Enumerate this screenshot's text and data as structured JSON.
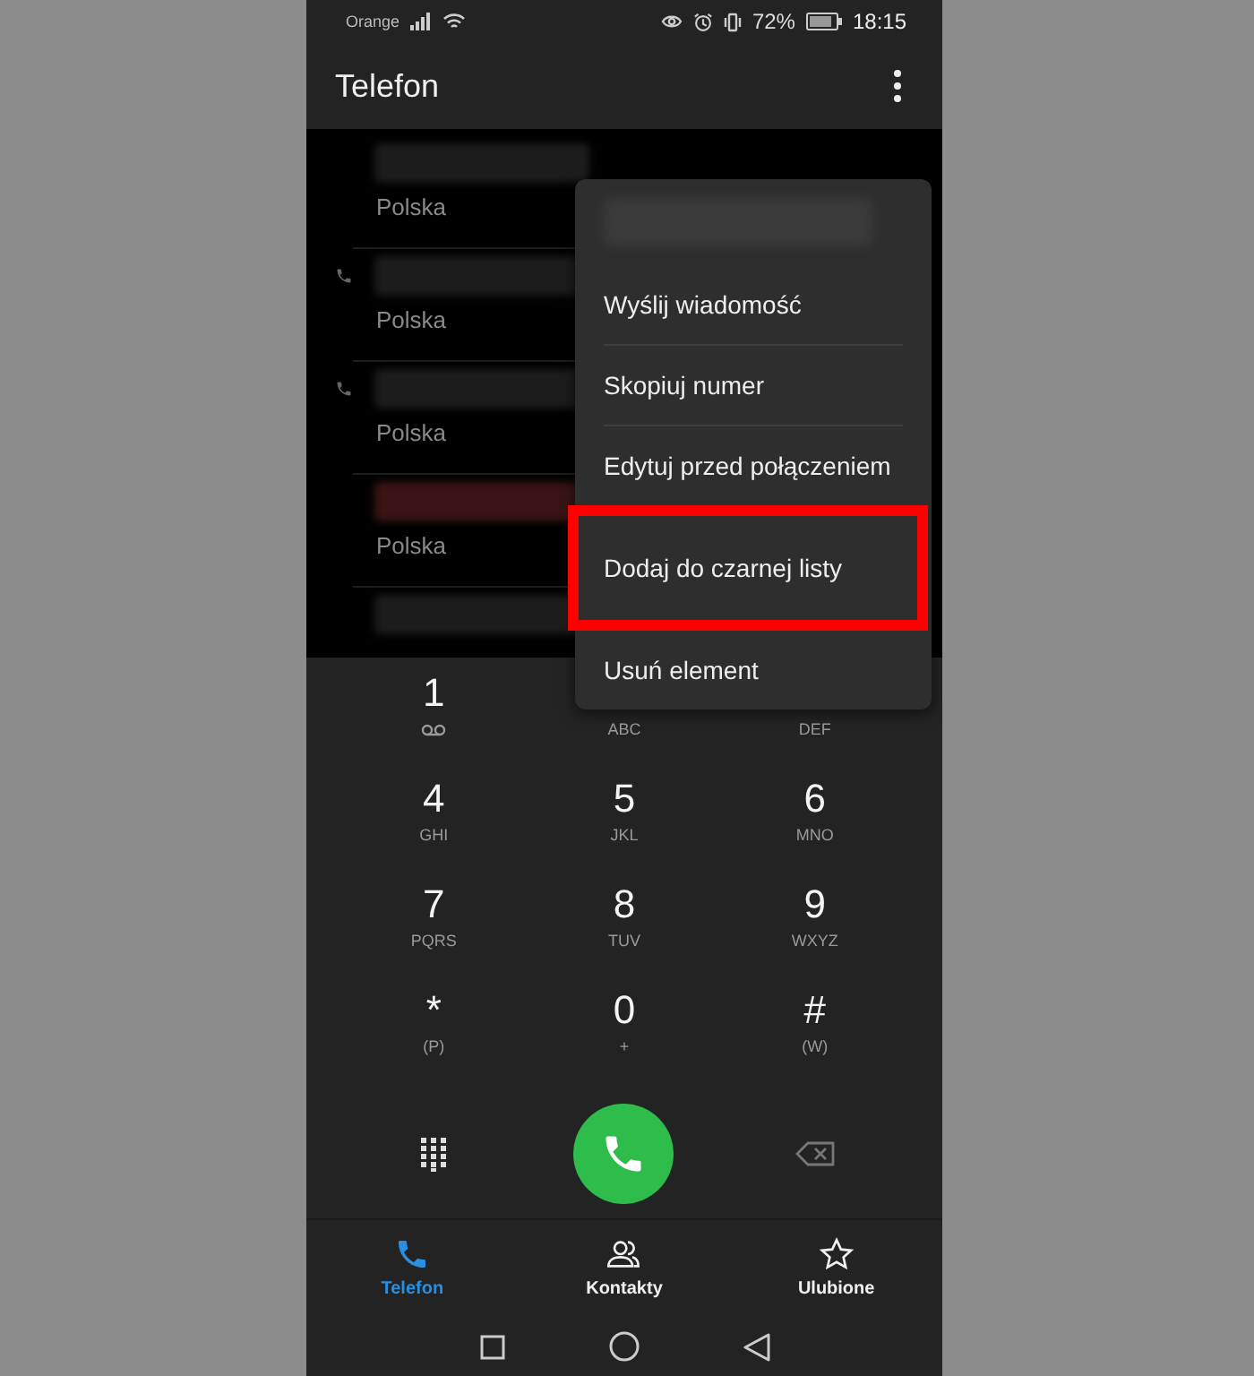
{
  "status_bar": {
    "carrier": "Orange",
    "battery": "72%",
    "time": "18:15"
  },
  "header": {
    "title": "Telefon"
  },
  "call_log": [
    {
      "country": "Polska",
      "missed": false,
      "icon": false
    },
    {
      "country": "Polska",
      "missed": false,
      "icon": true
    },
    {
      "country": "Polska",
      "missed": false,
      "icon": true
    },
    {
      "country": "Polska",
      "missed": true,
      "icon": false
    }
  ],
  "context_menu": {
    "items": [
      {
        "label": "Wyślij wiadomość",
        "highlighted": false
      },
      {
        "label": "Skopiuj numer",
        "highlighted": false
      },
      {
        "label": "Edytuj przed połączeniem",
        "highlighted": false
      },
      {
        "label": "Dodaj do czarnej listy",
        "highlighted": true
      },
      {
        "label": "Usuń element",
        "highlighted": false
      }
    ]
  },
  "keypad": [
    {
      "kind": "voicemail",
      "digit": "1"
    },
    {
      "kind": "letters",
      "letters": "ABC"
    },
    {
      "kind": "letters",
      "letters": "DEF"
    },
    {
      "kind": "letters",
      "digit": "4",
      "letters": "GHI"
    },
    {
      "kind": "letters",
      "digit": "5",
      "letters": "JKL"
    },
    {
      "kind": "letters",
      "digit": "6",
      "letters": "MNO"
    },
    {
      "kind": "letters",
      "digit": "7",
      "letters": "PQRS"
    },
    {
      "kind": "letters",
      "digit": "8",
      "letters": "TUV"
    },
    {
      "kind": "letters",
      "digit": "9",
      "letters": "WXYZ"
    },
    {
      "kind": "letters",
      "digit": "*",
      "letters": "(P)"
    },
    {
      "kind": "letters",
      "digit": "0",
      "letters": "+"
    },
    {
      "kind": "letters",
      "digit": "#",
      "letters": "(W)"
    }
  ],
  "tabs": [
    {
      "label": "Telefon",
      "kind": "phone",
      "selected": true
    },
    {
      "label": "Kontakty",
      "kind": "contacts",
      "selected": false
    },
    {
      "label": "Ulubione",
      "kind": "star",
      "selected": false
    }
  ]
}
